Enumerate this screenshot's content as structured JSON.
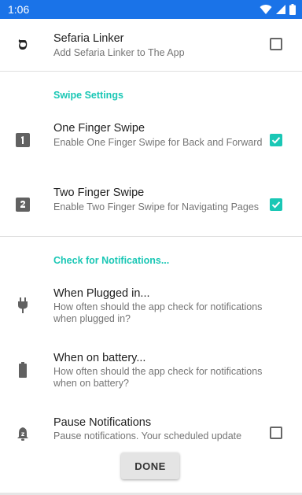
{
  "status_bar": {
    "time": "1:06",
    "icons": [
      "wifi-icon",
      "signal-icon",
      "battery-icon"
    ],
    "color": "#1a73e8"
  },
  "accent_color": "#1ac7b5",
  "sefaria": {
    "icon": "hebrew-letter-icon",
    "icon_glyph": "ס",
    "title": "Sefaria Linker",
    "summary": "Add Sefaria Linker to The App",
    "checked": false
  },
  "swipe_category": "Swipe Settings",
  "one_finger": {
    "icon": "number-one-icon",
    "title": "One Finger Swipe",
    "summary": "Enable One Finger Swipe for Back and Forward",
    "checked": true
  },
  "two_finger": {
    "icon": "number-two-icon",
    "title": "Two Finger Swipe",
    "summary": "Enable Two Finger Swipe for Navigating Pages",
    "checked": true
  },
  "notifications_category": "Check for Notifications...",
  "plugged": {
    "icon": "power-plug-icon",
    "title": "When Plugged in...",
    "summary": "How often should the app check for notifications when plugged in?"
  },
  "battery": {
    "icon": "battery-icon",
    "title": "When on battery...",
    "summary": "How often should the app check for notifications when on battery?"
  },
  "pause": {
    "icon": "notifications-paused-icon",
    "title": "Pause Notifications",
    "summary": "Pause notifications. Your scheduled update",
    "checked": false
  },
  "done_button": "DONE"
}
